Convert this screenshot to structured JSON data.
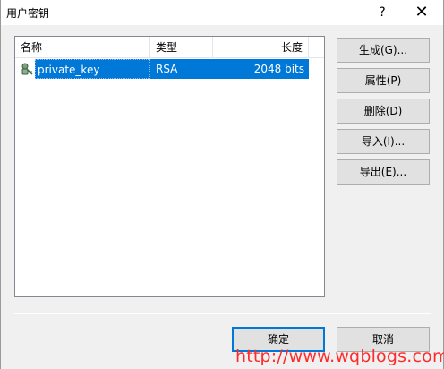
{
  "window": {
    "title": "用户密钥",
    "help_label": "?",
    "close_label": "✕"
  },
  "list": {
    "columns": [
      "名称",
      "类型",
      "长度"
    ],
    "rows": [
      {
        "name": "private_key",
        "type": "RSA",
        "length": "2048 bits",
        "icon": "key-icon",
        "selected": true
      }
    ]
  },
  "buttons": {
    "generate": "生成(G)...",
    "properties": "属性(P)",
    "delete": "删除(D)",
    "import": "导入(I)...",
    "export": "导出(E)...",
    "ok": "确定",
    "cancel": "取消"
  },
  "watermark": "http://www.wqblogs.com",
  "colors": {
    "selection": "#0078d7",
    "default_button_border": "#0078d7",
    "watermark": "#ff2a2a"
  }
}
